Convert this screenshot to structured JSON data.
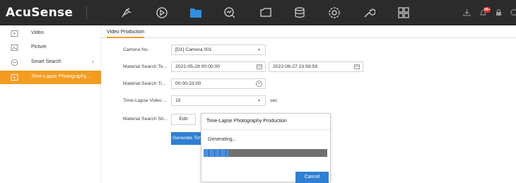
{
  "app": {
    "logo": "AcuSense"
  },
  "topnav": {
    "icons": [
      "live-view-icon",
      "playback-icon",
      "file-management-icon",
      "smart-analysis-icon",
      "monitor-icon",
      "storage-icon",
      "configuration-icon",
      "maintenance-icon",
      "multi-screen-icon"
    ],
    "active": "file-management-icon",
    "right_icons": [
      "download-icon",
      "alarm-icon",
      "lock-icon"
    ],
    "alarm_badge": "99+"
  },
  "sidebar": {
    "items": [
      {
        "label": "Video",
        "icon": "video-icon"
      },
      {
        "label": "Picture",
        "icon": "picture-icon"
      },
      {
        "label": "Smart Search",
        "icon": "smart-search-icon",
        "has_chevron": true
      },
      {
        "label": "Time-Lapse Photography...",
        "icon": "time-lapse-icon",
        "active": true
      }
    ]
  },
  "tab": {
    "label": "Video Production"
  },
  "form": {
    "camera": {
      "label": "Camera No.",
      "value": "[D1] Camera 001"
    },
    "material_time": {
      "label": "Material Search To...",
      "start": "2022-05-29 00:00:00",
      "end": "2022-06-27 23:59:59"
    },
    "material_time_period": {
      "label": "Material Search Ti...",
      "value": "00:00-23:00"
    },
    "video_duration": {
      "label": "Time-Lapse Video ...",
      "value": "15",
      "unit": "sec"
    },
    "material_shooting": {
      "label": "Material Search Sh...",
      "edit_label": "Edit"
    },
    "generate_label": "Generate Time-Lapse Video"
  },
  "dialog": {
    "title": "Time-Lapse Photography Production",
    "message": "Generating...",
    "progress": 0.2,
    "cancel_label": "Cancel"
  },
  "colors": {
    "topbar": "#2b2b2b",
    "accent": "#f39c1f",
    "primary": "#2f7fd2"
  }
}
